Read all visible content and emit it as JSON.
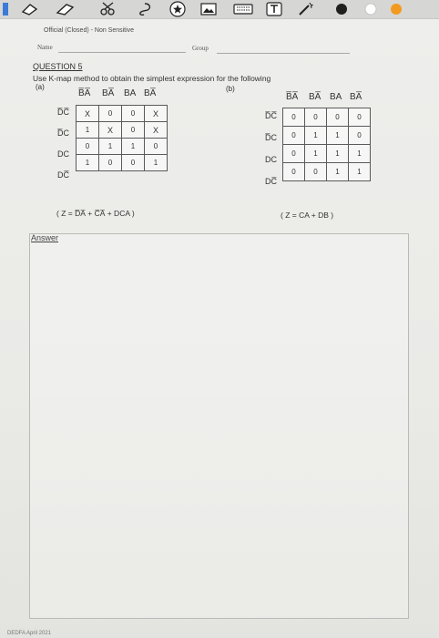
{
  "toolbar": {
    "icons": [
      "eraser-icon",
      "highlighter-icon",
      "scissors-icon",
      "lasso-icon",
      "star-icon",
      "image-icon",
      "keyboard-icon",
      "text-box-icon",
      "magic-wand-icon",
      "color-black",
      "color-white",
      "color-orange"
    ],
    "colors": {
      "black": "#1f1f1f",
      "white": "#ffffff",
      "orange": "#f29a1f",
      "accent_blue": "#3b7bd8"
    }
  },
  "document": {
    "classification": "Official (Closed) - Non Sensitive",
    "name_label": "Name",
    "group_label": "Group",
    "question_title": "QUESTION 5",
    "instruction": "Use K-map method to obtain the simplest expression for the following",
    "part_a_label": "(a)",
    "part_b_label": "(b)",
    "answer_label": "Answer",
    "footer": "DEDFA April 2021"
  },
  "kmap_a": {
    "col_headers": [
      "B̅A̅",
      "BA̅",
      "BA",
      "BA̅"
    ],
    "row_headers": [
      "D̅C̅",
      "D̅C",
      "DC",
      "DC̅"
    ],
    "cells": [
      [
        "X",
        "0",
        "0",
        "X"
      ],
      [
        "1",
        "X",
        "0",
        "X"
      ],
      [
        "0",
        "1",
        "1",
        "0"
      ],
      [
        "1",
        "0",
        "0",
        "1"
      ]
    ],
    "result": "( Z = D̅A̅ + C̅A̅ + DCA )"
  },
  "kmap_b": {
    "col_headers": [
      "B̅A̅",
      "BA̅",
      "BA",
      "BA̅"
    ],
    "row_headers": [
      "D̅C̅",
      "D̅C",
      "DC",
      "DC̅"
    ],
    "cells": [
      [
        "0",
        "0",
        "0",
        "0"
      ],
      [
        "0",
        "1",
        "1",
        "0"
      ],
      [
        "0",
        "1",
        "1",
        "1"
      ],
      [
        "0",
        "0",
        "1",
        "1"
      ]
    ],
    "result": "( Z = CA + DB )"
  }
}
